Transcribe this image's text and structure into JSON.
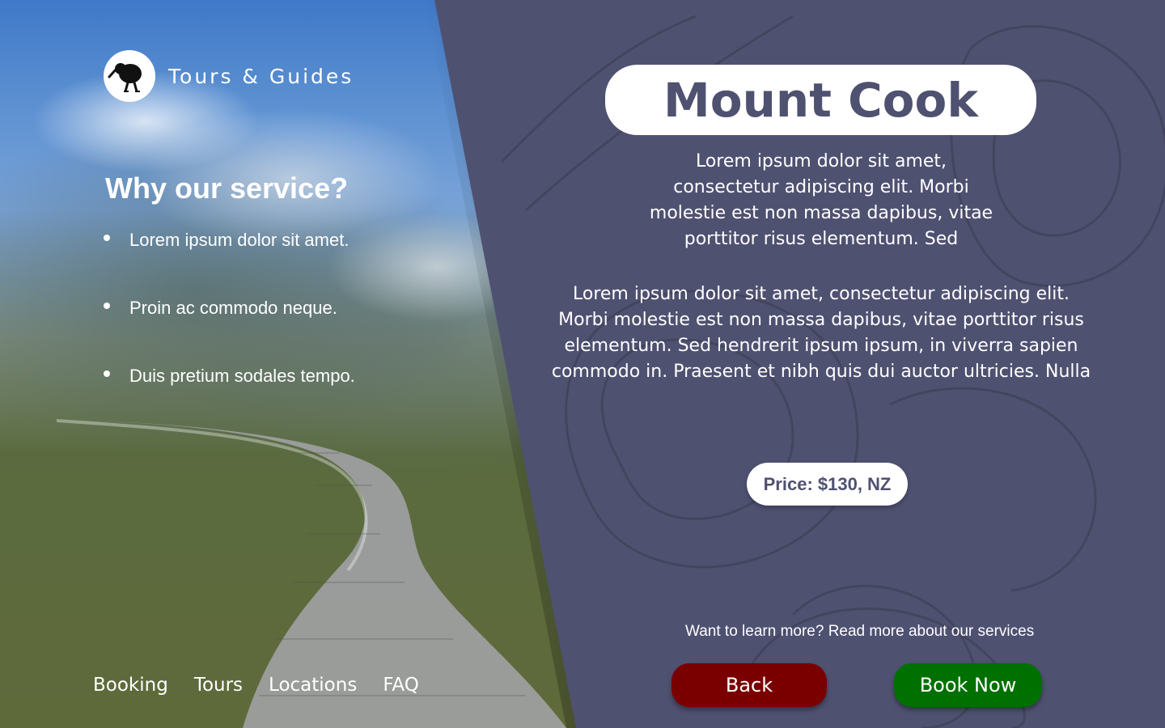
{
  "brand": {
    "name": "Tours & Guides",
    "logo_icon": "kiwi-bird-icon"
  },
  "why": {
    "title": "Why our service?",
    "items": [
      "Lorem ipsum dolor sit amet.",
      "Proin ac commodo neque.",
      "Duis pretium sodales tempo."
    ]
  },
  "nav": {
    "items": [
      "Booking",
      "Tours",
      "Locations",
      "FAQ"
    ]
  },
  "tour": {
    "title": "Mount Cook",
    "intro": "Lorem ipsum dolor sit amet, consectetur adipiscing elit. Morbi molestie est non massa dapibus, vitae porttitor risus elementum. Sed",
    "description": "Lorem ipsum dolor sit amet, consectetur adipiscing elit. Morbi molestie est non massa dapibus, vitae porttitor risus elementum. Sed hendrerit ipsum ipsum, in viverra sapien commodo in. Praesent et nibh quis dui auctor ultricies. Nulla",
    "price": "Price: $130, NZ",
    "learn_more": "Want to learn more? Read more about our services",
    "back_label": "Back",
    "book_label": "Book Now"
  },
  "colors": {
    "background": "#4f5171",
    "back_button": "#7a0000",
    "book_button": "#007000",
    "white": "#ffffff"
  }
}
